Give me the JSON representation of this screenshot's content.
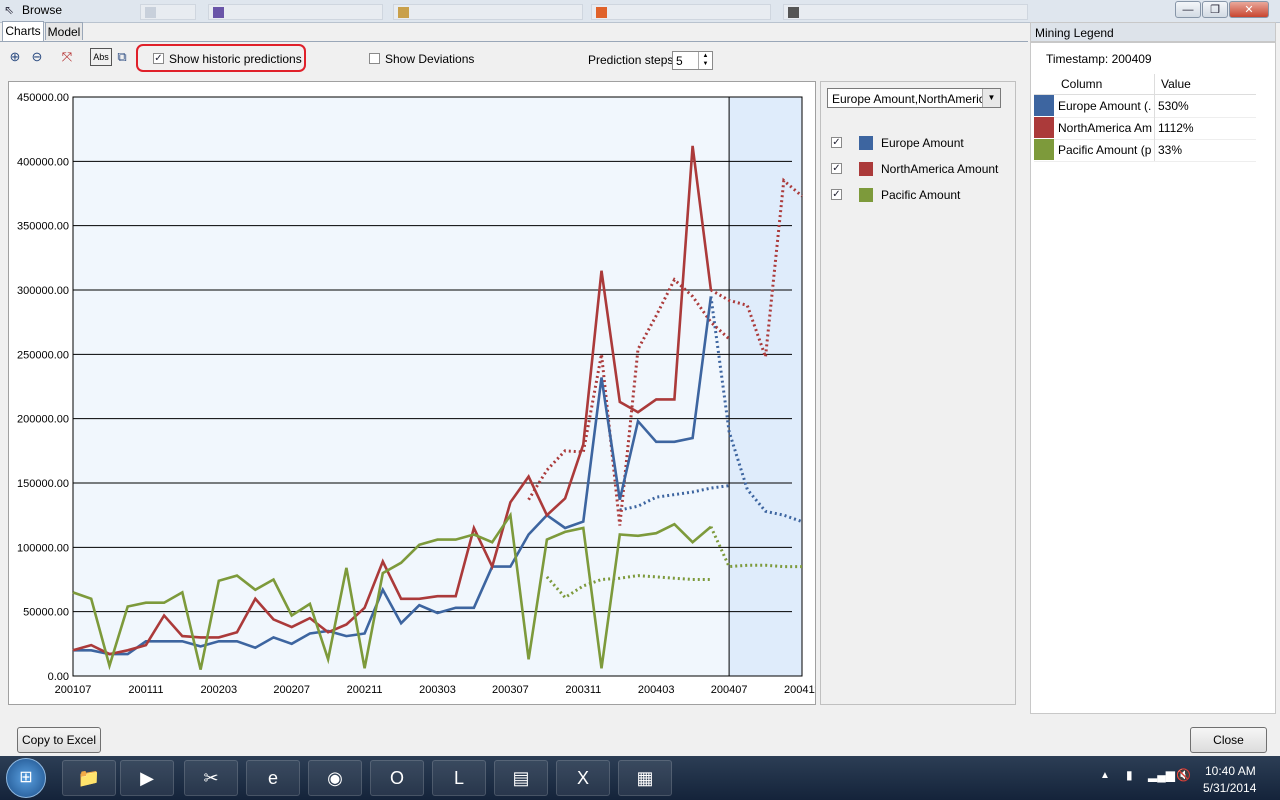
{
  "window": {
    "title": "Browse"
  },
  "tabs": [
    {
      "label": "Charts"
    },
    {
      "label": "Model"
    }
  ],
  "toolbar": {
    "show_historic_label": "Show historic predictions",
    "show_deviations_label": "Show Deviations",
    "prediction_steps_label": "Prediction steps",
    "prediction_steps_value": "5"
  },
  "series_select": {
    "value": "Europe Amount,NorthAmeric..."
  },
  "legend": [
    {
      "label": "Europe Amount",
      "color": "#3d65a0"
    },
    {
      "label": "NorthAmerica Amount",
      "color": "#ab3a3a"
    },
    {
      "label": "Pacific Amount",
      "color": "#7d9a3b"
    }
  ],
  "mining_legend": {
    "title": "Mining Legend",
    "timestamp": "Timestamp: 200409",
    "col_header": "Column",
    "val_header": "Value",
    "rows": [
      {
        "column": "Europe Amount (...",
        "value": "530%"
      },
      {
        "column": "NorthAmerica Am...",
        "value": "1112%"
      },
      {
        "column": "Pacific Amount (p...",
        "value": "33%"
      }
    ]
  },
  "buttons": {
    "copy_to_excel": "Copy to Excel",
    "close": "Close"
  },
  "taskbar": {
    "time": "10:40 AM",
    "date": "5/31/2014"
  },
  "chart_data": {
    "type": "line",
    "ylim": [
      0,
      450000
    ],
    "yticks": [
      "450000.00",
      "400000.00",
      "350000.00",
      "300000.00",
      "250000.00",
      "200000.00",
      "150000.00",
      "100000.00",
      "50000.00",
      "0.00"
    ],
    "xticks": [
      "200107",
      "200111",
      "200203",
      "200207",
      "200211",
      "200303",
      "200307",
      "200311",
      "200403",
      "200407",
      "200411"
    ],
    "x": [
      "200107",
      "200108",
      "200109",
      "200110",
      "200111",
      "200112",
      "200201",
      "200202",
      "200203",
      "200204",
      "200205",
      "200206",
      "200207",
      "200208",
      "200209",
      "200210",
      "200211",
      "200212",
      "200301",
      "200302",
      "200303",
      "200304",
      "200305",
      "200306",
      "200307",
      "200308",
      "200309",
      "200310",
      "200311",
      "200312",
      "200401",
      "200402",
      "200403",
      "200404",
      "200405",
      "200406",
      "200407",
      "200408",
      "200409",
      "200410",
      "200411"
    ],
    "series": [
      {
        "name": "Europe Amount",
        "color": "#3d65a0",
        "actual": [
          20000,
          20000,
          17000,
          17000,
          27000,
          27000,
          27000,
          23000,
          27000,
          27000,
          22000,
          30000,
          25000,
          33000,
          35000,
          31000,
          33000,
          67000,
          41000,
          55000,
          49000,
          53000,
          53000,
          85000,
          85000,
          110000,
          125000,
          115000,
          120000,
          232000,
          137000,
          198000,
          182000,
          182000,
          185000,
          295000
        ],
        "historic": [
          null,
          null,
          null,
          null,
          null,
          null,
          null,
          null,
          null,
          null,
          null,
          null,
          null,
          null,
          null,
          null,
          null,
          null,
          null,
          null,
          null,
          null,
          null,
          null,
          null,
          null,
          null,
          null,
          null,
          null,
          129000,
          132000,
          139000,
          141000,
          143000,
          146000,
          148000
        ],
        "future": [
          null,
          null,
          null,
          null,
          null,
          null,
          null,
          null,
          null,
          null,
          null,
          null,
          null,
          null,
          null,
          null,
          null,
          null,
          null,
          null,
          null,
          null,
          null,
          null,
          null,
          null,
          null,
          null,
          null,
          null,
          null,
          null,
          null,
          null,
          null,
          295000,
          190000,
          145000,
          128000,
          125000,
          120000
        ]
      },
      {
        "name": "NorthAmerica Amount",
        "color": "#ab3a3a",
        "actual": [
          20000,
          24000,
          17000,
          20000,
          24000,
          47000,
          31000,
          30000,
          30000,
          34000,
          60000,
          44000,
          38000,
          45000,
          34000,
          40000,
          53000,
          89000,
          60000,
          60000,
          62000,
          62000,
          115000,
          85000,
          135000,
          155000,
          125000,
          138000,
          180000,
          315000,
          213000,
          205000,
          215000,
          215000,
          412000,
          300000
        ],
        "historic": [
          null,
          null,
          null,
          null,
          null,
          null,
          null,
          null,
          null,
          null,
          null,
          null,
          null,
          null,
          null,
          null,
          null,
          null,
          null,
          null,
          null,
          null,
          null,
          null,
          null,
          137000,
          160000,
          175000,
          174000,
          250000,
          117000,
          254000,
          280000,
          308000,
          295000,
          275000,
          262000
        ],
        "future": [
          null,
          null,
          null,
          null,
          null,
          null,
          null,
          null,
          null,
          null,
          null,
          null,
          null,
          null,
          null,
          null,
          null,
          null,
          null,
          null,
          null,
          null,
          null,
          null,
          null,
          null,
          null,
          null,
          null,
          null,
          null,
          null,
          null,
          null,
          null,
          300000,
          292000,
          288000,
          248000,
          385000,
          373000
        ]
      },
      {
        "name": "Pacific Amount",
        "color": "#7d9a3b",
        "actual": [
          65000,
          60000,
          8000,
          54000,
          57000,
          57000,
          65000,
          5000,
          74000,
          78000,
          67000,
          75000,
          47000,
          56000,
          13000,
          84000,
          6000,
          80000,
          88000,
          102000,
          106000,
          106000,
          110000,
          104000,
          125000,
          13000,
          106000,
          112000,
          115000,
          6000,
          110000,
          109000,
          111000,
          118000,
          104000,
          116000
        ],
        "historic": [
          null,
          null,
          null,
          null,
          null,
          null,
          null,
          null,
          null,
          null,
          null,
          null,
          null,
          null,
          null,
          null,
          null,
          null,
          null,
          null,
          null,
          null,
          null,
          null,
          null,
          null,
          77000,
          61000,
          70000,
          75000,
          76000,
          78000,
          77000,
          76000,
          75000,
          75000
        ],
        "future": [
          null,
          null,
          null,
          null,
          null,
          null,
          null,
          null,
          null,
          null,
          null,
          null,
          null,
          null,
          null,
          null,
          null,
          null,
          null,
          null,
          null,
          null,
          null,
          null,
          null,
          null,
          null,
          null,
          null,
          null,
          null,
          null,
          null,
          null,
          null,
          116000,
          85000,
          86000,
          86000,
          85000,
          85000
        ]
      }
    ]
  }
}
